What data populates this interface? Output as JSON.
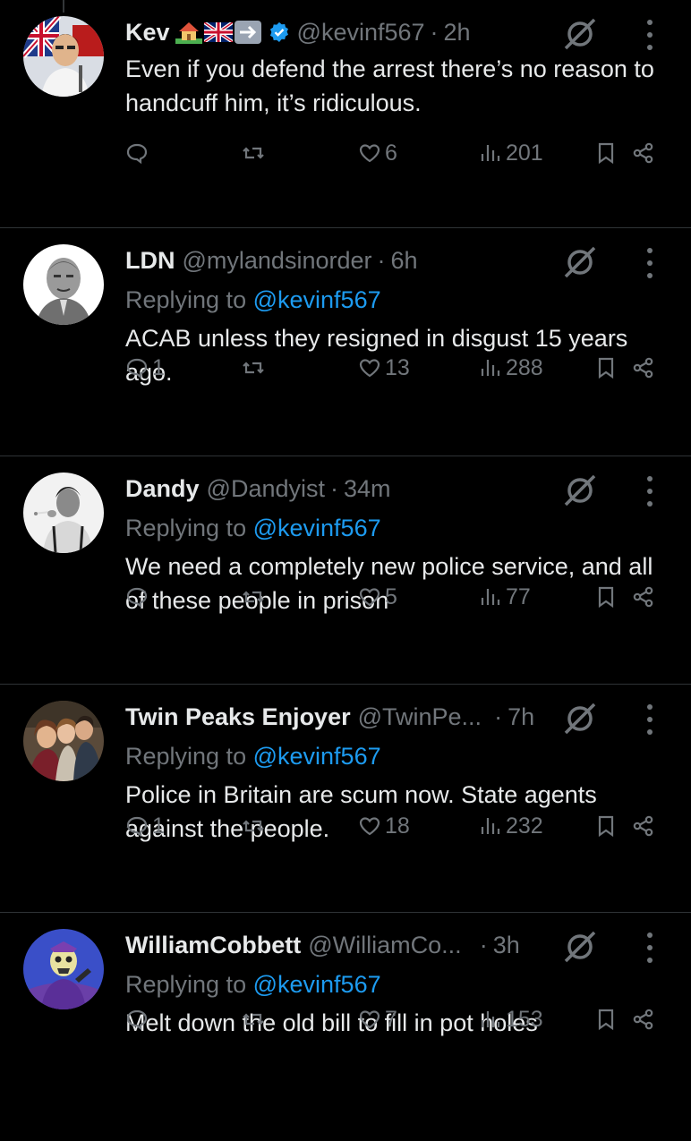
{
  "tweets": [
    {
      "name": "Kev",
      "handle": "@kevinf567",
      "time": "2h",
      "verified": true,
      "emojis": [
        "house-icon",
        "uk-flag-icon",
        "arrow-right-icon"
      ],
      "replying_to": "",
      "text": "Even if you defend the arrest there’s no reason to handcuff him, it’s ridiculous.",
      "replies": "",
      "retweets": "",
      "likes": "6",
      "views": "201"
    },
    {
      "name": "LDN",
      "handle": "@mylandsinorder",
      "time": "6h",
      "verified": false,
      "replying_prefix": "Replying to",
      "replying_to": "@kevinf567",
      "text": "ACAB unless they resigned in disgust 15 years ago.",
      "replies": "1",
      "retweets": "",
      "likes": "13",
      "views": "288"
    },
    {
      "name": "Dandy",
      "handle": "@Dandyist",
      "time": "34m",
      "verified": false,
      "replying_prefix": "Replying to",
      "replying_to": "@kevinf567",
      "text": "We need a completely new police service, and all of these people in prison",
      "replies": "",
      "retweets": "",
      "likes": "5",
      "views": "77"
    },
    {
      "name": "Twin Peaks Enjoyer",
      "handle": "@TwinPe...",
      "time": "7h",
      "verified": false,
      "replying_prefix": "Replying to",
      "replying_to": "@kevinf567",
      "text": "Police in Britain are scum now. State agents against the people.",
      "replies": "1",
      "retweets": "",
      "likes": "18",
      "views": "232"
    },
    {
      "name": "WilliamCobbett",
      "handle": "@WilliamCo...",
      "time": "3h",
      "verified": false,
      "replying_prefix": "Replying to",
      "replying_to": "@kevinf567",
      "text": "Melt down the old bill to fill in pot holes",
      "replies": "",
      "retweets": "",
      "likes": "7",
      "views": "153"
    }
  ],
  "separator": "·",
  "colors": {
    "background": "#000000",
    "text": "#e7e9ea",
    "muted": "#71767b",
    "accent": "#1d9bf0",
    "divider": "#2f3336"
  }
}
